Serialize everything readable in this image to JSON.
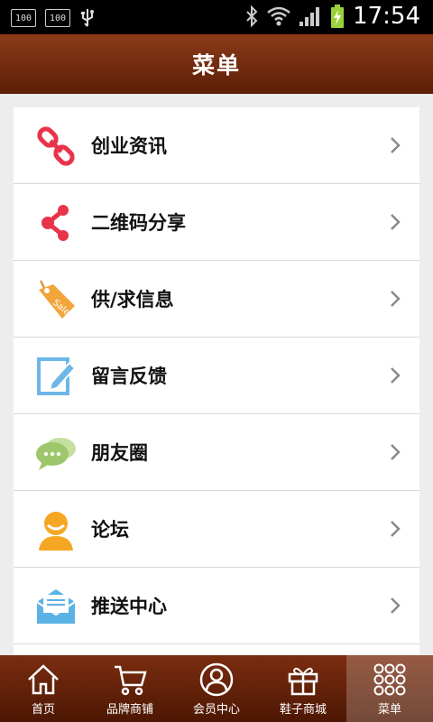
{
  "status_bar": {
    "badges": [
      "100",
      "100"
    ],
    "time": "17:54"
  },
  "header": {
    "title": "菜单"
  },
  "menu": {
    "items": [
      {
        "label": "创业资讯",
        "icon": "link-icon"
      },
      {
        "label": "二维码分享",
        "icon": "share-icon"
      },
      {
        "label": "供/求信息",
        "icon": "sale-tag-icon"
      },
      {
        "label": "留言反馈",
        "icon": "edit-note-icon"
      },
      {
        "label": "朋友圈",
        "icon": "chat-bubbles-icon"
      },
      {
        "label": "论坛",
        "icon": "person-icon"
      },
      {
        "label": "推送中心",
        "icon": "mail-icon"
      }
    ]
  },
  "tabbar": {
    "tabs": [
      {
        "label": "首页",
        "icon": "home-icon"
      },
      {
        "label": "品牌商铺",
        "icon": "cart-icon"
      },
      {
        "label": "会员中心",
        "icon": "member-icon"
      },
      {
        "label": "鞋子商城",
        "icon": "gift-icon"
      },
      {
        "label": "菜单",
        "icon": "grid-icon"
      }
    ],
    "active_index": 4
  },
  "colors": {
    "header_start": "#8b3a18",
    "header_end": "#5c1f07",
    "link_red": "#e8344a",
    "tag_orange": "#f2a53a",
    "edit_blue": "#6cb7e8",
    "chat_green": "#9dc76a",
    "person_orange": "#f5a623",
    "mail_blue": "#5ab2e6"
  }
}
